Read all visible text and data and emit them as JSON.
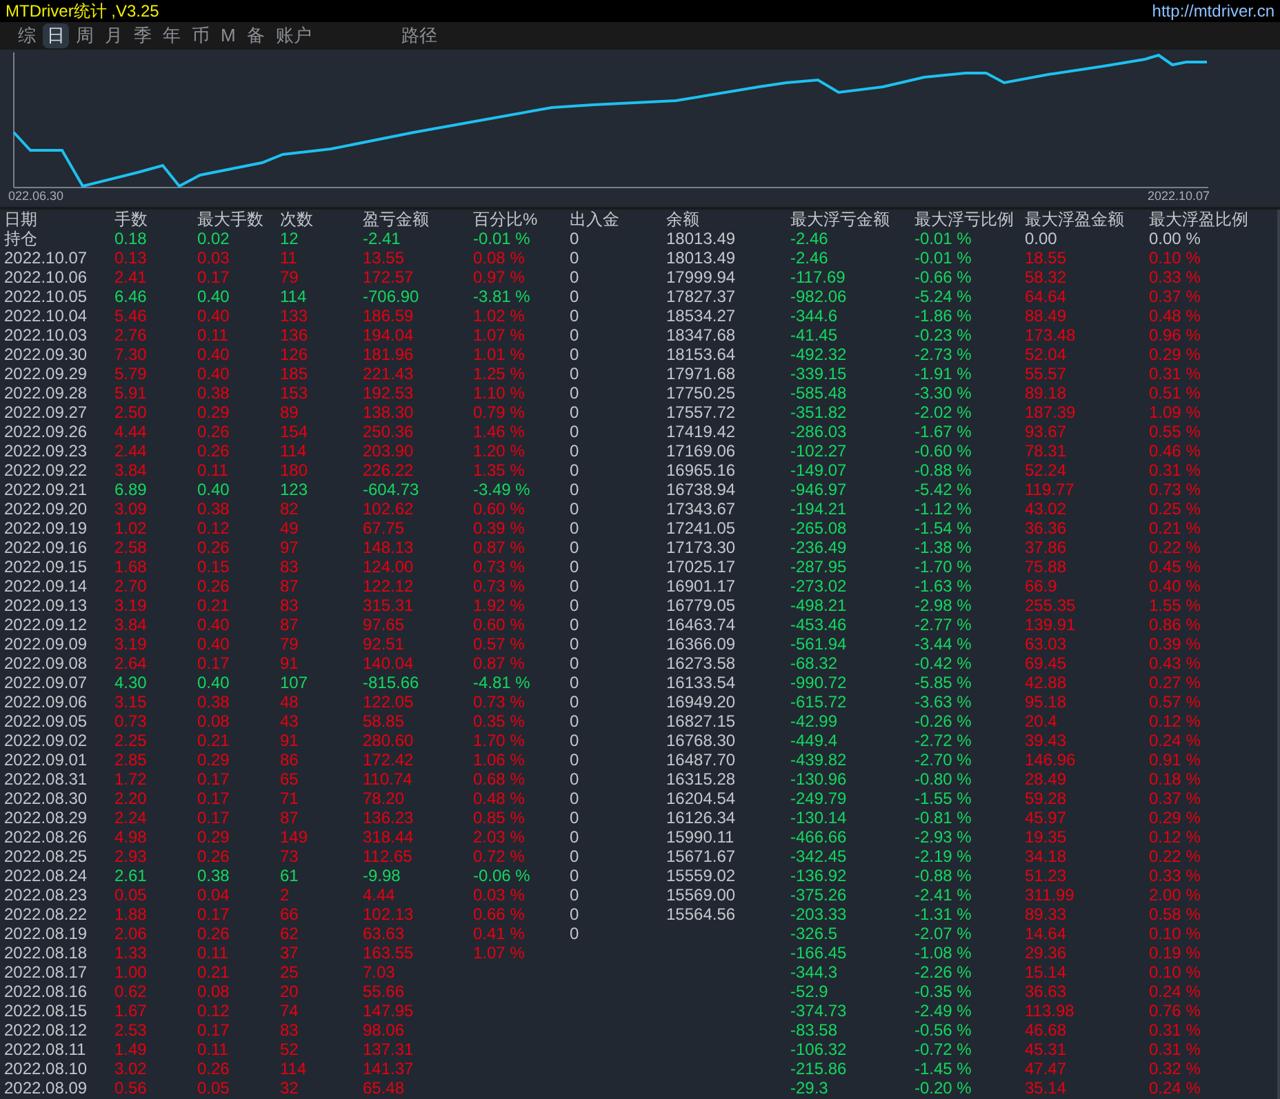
{
  "window": {
    "title": "MTDriver统计 ,V3.25",
    "link": "http://mtdriver.cn"
  },
  "tabs": [
    {
      "label": "综",
      "selected": false
    },
    {
      "label": "日",
      "selected": true
    },
    {
      "label": "周",
      "selected": false
    },
    {
      "label": "月",
      "selected": false
    },
    {
      "label": "季",
      "selected": false
    },
    {
      "label": "年",
      "selected": false
    },
    {
      "label": "币",
      "selected": false
    },
    {
      "label": "M",
      "selected": false
    },
    {
      "label": "备",
      "selected": false
    },
    {
      "label": "账户",
      "selected": false
    }
  ],
  "path_label": "路径",
  "chart": {
    "start_label": "022.06.30",
    "end_label": "2022.10.07"
  },
  "table": {
    "columns": [
      "日期",
      "手数",
      "最大手数",
      "次数",
      "盈亏金额",
      "百分比%",
      "出入金",
      "余额",
      "最大浮亏金额",
      "最大浮亏比例",
      "最大浮盈金额",
      "最大浮盈比例"
    ],
    "rows": [
      {
        "cells": [
          "持仓",
          "0.18",
          "0.02",
          "12",
          "-2.41",
          "-0.01 %",
          "0",
          "18013.49",
          "-2.46",
          "-0.01 %",
          "0.00",
          "0.00 %"
        ],
        "loss": true,
        "peak_flat": true
      },
      {
        "cells": [
          "2022.10.07",
          "0.13",
          "0.03",
          "11",
          "13.55",
          "0.08 %",
          "0",
          "18013.49",
          "-2.46",
          "-0.01 %",
          "18.55",
          "0.10 %"
        ],
        "loss": false,
        "peak_flat": false
      },
      {
        "cells": [
          "2022.10.06",
          "2.41",
          "0.17",
          "79",
          "172.57",
          "0.97 %",
          "0",
          "17999.94",
          "-117.69",
          "-0.66 %",
          "58.32",
          "0.33 %"
        ],
        "loss": false,
        "peak_flat": false
      },
      {
        "cells": [
          "2022.10.05",
          "6.46",
          "0.40",
          "114",
          "-706.90",
          "-3.81 %",
          "0",
          "17827.37",
          "-982.06",
          "-5.24 %",
          "64.64",
          "0.37 %"
        ],
        "loss": true,
        "peak_flat": false
      },
      {
        "cells": [
          "2022.10.04",
          "5.46",
          "0.40",
          "133",
          "186.59",
          "1.02 %",
          "0",
          "18534.27",
          "-344.6",
          "-1.86 %",
          "88.49",
          "0.48 %"
        ],
        "loss": false,
        "peak_flat": false
      },
      {
        "cells": [
          "2022.10.03",
          "2.76",
          "0.11",
          "136",
          "194.04",
          "1.07 %",
          "0",
          "18347.68",
          "-41.45",
          "-0.23 %",
          "173.48",
          "0.96 %"
        ],
        "loss": false,
        "peak_flat": false
      },
      {
        "cells": [
          "2022.09.30",
          "7.30",
          "0.40",
          "126",
          "181.96",
          "1.01 %",
          "0",
          "18153.64",
          "-492.32",
          "-2.73 %",
          "52.04",
          "0.29 %"
        ],
        "loss": false,
        "peak_flat": false
      },
      {
        "cells": [
          "2022.09.29",
          "5.79",
          "0.40",
          "185",
          "221.43",
          "1.25 %",
          "0",
          "17971.68",
          "-339.15",
          "-1.91 %",
          "55.57",
          "0.31 %"
        ],
        "loss": false,
        "peak_flat": false
      },
      {
        "cells": [
          "2022.09.28",
          "5.91",
          "0.38",
          "153",
          "192.53",
          "1.10 %",
          "0",
          "17750.25",
          "-585.48",
          "-3.30 %",
          "89.18",
          "0.51 %"
        ],
        "loss": false,
        "peak_flat": false
      },
      {
        "cells": [
          "2022.09.27",
          "2.50",
          "0.29",
          "89",
          "138.30",
          "0.79 %",
          "0",
          "17557.72",
          "-351.82",
          "-2.02 %",
          "187.39",
          "1.09 %"
        ],
        "loss": false,
        "peak_flat": false
      },
      {
        "cells": [
          "2022.09.26",
          "4.44",
          "0.26",
          "154",
          "250.36",
          "1.46 %",
          "0",
          "17419.42",
          "-286.03",
          "-1.67 %",
          "93.67",
          "0.55 %"
        ],
        "loss": false,
        "peak_flat": false
      },
      {
        "cells": [
          "2022.09.23",
          "2.44",
          "0.26",
          "114",
          "203.90",
          "1.20 %",
          "0",
          "17169.06",
          "-102.27",
          "-0.60 %",
          "78.31",
          "0.46 %"
        ],
        "loss": false,
        "peak_flat": false
      },
      {
        "cells": [
          "2022.09.22",
          "3.84",
          "0.11",
          "180",
          "226.22",
          "1.35 %",
          "0",
          "16965.16",
          "-149.07",
          "-0.88 %",
          "52.24",
          "0.31 %"
        ],
        "loss": false,
        "peak_flat": false
      },
      {
        "cells": [
          "2022.09.21",
          "6.89",
          "0.40",
          "123",
          "-604.73",
          "-3.49 %",
          "0",
          "16738.94",
          "-946.97",
          "-5.42 %",
          "119.77",
          "0.73 %"
        ],
        "loss": true,
        "peak_flat": false
      },
      {
        "cells": [
          "2022.09.20",
          "3.09",
          "0.38",
          "82",
          "102.62",
          "0.60 %",
          "0",
          "17343.67",
          "-194.21",
          "-1.12 %",
          "43.02",
          "0.25 %"
        ],
        "loss": false,
        "peak_flat": false
      },
      {
        "cells": [
          "2022.09.19",
          "1.02",
          "0.12",
          "49",
          "67.75",
          "0.39 %",
          "0",
          "17241.05",
          "-265.08",
          "-1.54 %",
          "36.36",
          "0.21 %"
        ],
        "loss": false,
        "peak_flat": false
      },
      {
        "cells": [
          "2022.09.16",
          "2.58",
          "0.26",
          "97",
          "148.13",
          "0.87 %",
          "0",
          "17173.30",
          "-236.49",
          "-1.38 %",
          "37.86",
          "0.22 %"
        ],
        "loss": false,
        "peak_flat": false
      },
      {
        "cells": [
          "2022.09.15",
          "1.68",
          "0.15",
          "83",
          "124.00",
          "0.73 %",
          "0",
          "17025.17",
          "-287.95",
          "-1.70 %",
          "75.88",
          "0.45 %"
        ],
        "loss": false,
        "peak_flat": false
      },
      {
        "cells": [
          "2022.09.14",
          "2.70",
          "0.26",
          "87",
          "122.12",
          "0.73 %",
          "0",
          "16901.17",
          "-273.02",
          "-1.63 %",
          "66.9",
          "0.40 %"
        ],
        "loss": false,
        "peak_flat": false
      },
      {
        "cells": [
          "2022.09.13",
          "3.19",
          "0.21",
          "83",
          "315.31",
          "1.92 %",
          "0",
          "16779.05",
          "-498.21",
          "-2.98 %",
          "255.35",
          "1.55 %"
        ],
        "loss": false,
        "peak_flat": false
      },
      {
        "cells": [
          "2022.09.12",
          "3.84",
          "0.40",
          "87",
          "97.65",
          "0.60 %",
          "0",
          "16463.74",
          "-453.46",
          "-2.77 %",
          "139.91",
          "0.86 %"
        ],
        "loss": false,
        "peak_flat": false
      },
      {
        "cells": [
          "2022.09.09",
          "3.19",
          "0.40",
          "79",
          "92.51",
          "0.57 %",
          "0",
          "16366.09",
          "-561.94",
          "-3.44 %",
          "63.03",
          "0.39 %"
        ],
        "loss": false,
        "peak_flat": false
      },
      {
        "cells": [
          "2022.09.08",
          "2.64",
          "0.17",
          "91",
          "140.04",
          "0.87 %",
          "0",
          "16273.58",
          "-68.32",
          "-0.42 %",
          "69.45",
          "0.43 %"
        ],
        "loss": false,
        "peak_flat": false
      },
      {
        "cells": [
          "2022.09.07",
          "4.30",
          "0.40",
          "107",
          "-815.66",
          "-4.81 %",
          "0",
          "16133.54",
          "-990.72",
          "-5.85 %",
          "42.88",
          "0.27 %"
        ],
        "loss": true,
        "peak_flat": false
      },
      {
        "cells": [
          "2022.09.06",
          "3.15",
          "0.38",
          "48",
          "122.05",
          "0.73 %",
          "0",
          "16949.20",
          "-615.72",
          "-3.63 %",
          "95.18",
          "0.57 %"
        ],
        "loss": false,
        "peak_flat": false
      },
      {
        "cells": [
          "2022.09.05",
          "0.73",
          "0.08",
          "43",
          "58.85",
          "0.35 %",
          "0",
          "16827.15",
          "-42.99",
          "-0.26 %",
          "20.4",
          "0.12 %"
        ],
        "loss": false,
        "peak_flat": false
      },
      {
        "cells": [
          "2022.09.02",
          "2.25",
          "0.21",
          "91",
          "280.60",
          "1.70 %",
          "0",
          "16768.30",
          "-449.4",
          "-2.72 %",
          "39.43",
          "0.24 %"
        ],
        "loss": false,
        "peak_flat": false
      },
      {
        "cells": [
          "2022.09.01",
          "2.85",
          "0.29",
          "86",
          "172.42",
          "1.06 %",
          "0",
          "16487.70",
          "-439.82",
          "-2.70 %",
          "146.96",
          "0.91 %"
        ],
        "loss": false,
        "peak_flat": false
      },
      {
        "cells": [
          "2022.08.31",
          "1.72",
          "0.17",
          "65",
          "110.74",
          "0.68 %",
          "0",
          "16315.28",
          "-130.96",
          "-0.80 %",
          "28.49",
          "0.18 %"
        ],
        "loss": false,
        "peak_flat": false
      },
      {
        "cells": [
          "2022.08.30",
          "2.20",
          "0.17",
          "71",
          "78.20",
          "0.48 %",
          "0",
          "16204.54",
          "-249.79",
          "-1.55 %",
          "59.28",
          "0.37 %"
        ],
        "loss": false,
        "peak_flat": false
      },
      {
        "cells": [
          "2022.08.29",
          "2.24",
          "0.17",
          "87",
          "136.23",
          "0.85 %",
          "0",
          "16126.34",
          "-130.14",
          "-0.81 %",
          "45.97",
          "0.29 %"
        ],
        "loss": false,
        "peak_flat": false
      },
      {
        "cells": [
          "2022.08.26",
          "4.98",
          "0.29",
          "149",
          "318.44",
          "2.03 %",
          "0",
          "15990.11",
          "-466.66",
          "-2.93 %",
          "19.35",
          "0.12 %"
        ],
        "loss": false,
        "peak_flat": false
      },
      {
        "cells": [
          "2022.08.25",
          "2.93",
          "0.26",
          "73",
          "112.65",
          "0.72 %",
          "0",
          "15671.67",
          "-342.45",
          "-2.19 %",
          "34.18",
          "0.22 %"
        ],
        "loss": false,
        "peak_flat": false
      },
      {
        "cells": [
          "2022.08.24",
          "2.61",
          "0.38",
          "61",
          "-9.98",
          "-0.06 %",
          "0",
          "15559.02",
          "-136.92",
          "-0.88 %",
          "51.23",
          "0.33 %"
        ],
        "loss": true,
        "peak_flat": false
      },
      {
        "cells": [
          "2022.08.23",
          "0.05",
          "0.04",
          "2",
          "4.44",
          "0.03 %",
          "0",
          "15569.00",
          "-375.26",
          "-2.41 %",
          "311.99",
          "2.00 %"
        ],
        "loss": false,
        "peak_flat": false
      },
      {
        "cells": [
          "2022.08.22",
          "1.88",
          "0.17",
          "66",
          "102.13",
          "0.66 %",
          "0",
          "15564.56",
          "-203.33",
          "-1.31 %",
          "89.33",
          "0.58 %"
        ],
        "loss": false,
        "peak_flat": false
      },
      {
        "cells": [
          "2022.08.19",
          "2.06",
          "0.26",
          "62",
          "63.63",
          "0.41 %",
          "0",
          null,
          "-326.5",
          "-2.07 %",
          "14.64",
          "0.10 %"
        ],
        "loss": false,
        "peak_flat": false
      },
      {
        "cells": [
          "2022.08.18",
          "1.33",
          "0.11",
          "37",
          "163.55",
          "1.07 %",
          null,
          null,
          "-166.45",
          "-1.08 %",
          "29.36",
          "0.19 %"
        ],
        "loss": false,
        "peak_flat": false
      },
      {
        "cells": [
          "2022.08.17",
          "1.00",
          "0.21",
          "25",
          "7.03",
          null,
          null,
          null,
          "-344.3",
          "-2.26 %",
          "15.14",
          "0.10 %"
        ],
        "loss": false,
        "peak_flat": false
      },
      {
        "cells": [
          "2022.08.16",
          "0.62",
          "0.08",
          "20",
          "55.66",
          null,
          null,
          null,
          "-52.9",
          "-0.35 %",
          "36.63",
          "0.24 %"
        ],
        "loss": false,
        "peak_flat": false
      },
      {
        "cells": [
          "2022.08.15",
          "1.67",
          "0.12",
          "74",
          "147.95",
          null,
          null,
          null,
          "-374.73",
          "-2.49 %",
          "113.98",
          "0.76 %"
        ],
        "loss": false,
        "peak_flat": false
      },
      {
        "cells": [
          "2022.08.12",
          "2.53",
          "0.17",
          "83",
          "98.06",
          null,
          null,
          null,
          "-83.58",
          "-0.56 %",
          "46.68",
          "0.31 %"
        ],
        "loss": false,
        "peak_flat": false
      },
      {
        "cells": [
          "2022.08.11",
          "1.49",
          "0.11",
          "52",
          "137.31",
          null,
          null,
          null,
          "-106.32",
          "-0.72 %",
          "45.31",
          "0.31 %"
        ],
        "loss": false,
        "peak_flat": false
      },
      {
        "cells": [
          "2022.08.10",
          "3.02",
          "0.26",
          "114",
          "141.37",
          null,
          null,
          null,
          "-215.86",
          "-1.45 %",
          "47.47",
          "0.32 %"
        ],
        "loss": false,
        "peak_flat": false
      },
      {
        "cells": [
          "2022.08.09",
          "0.56",
          "0.05",
          "32",
          "65.48",
          null,
          null,
          null,
          "-29.3",
          "-0.20 %",
          "35.14",
          "0.24 %"
        ],
        "loss": false,
        "peak_flat": false
      }
    ]
  }
}
